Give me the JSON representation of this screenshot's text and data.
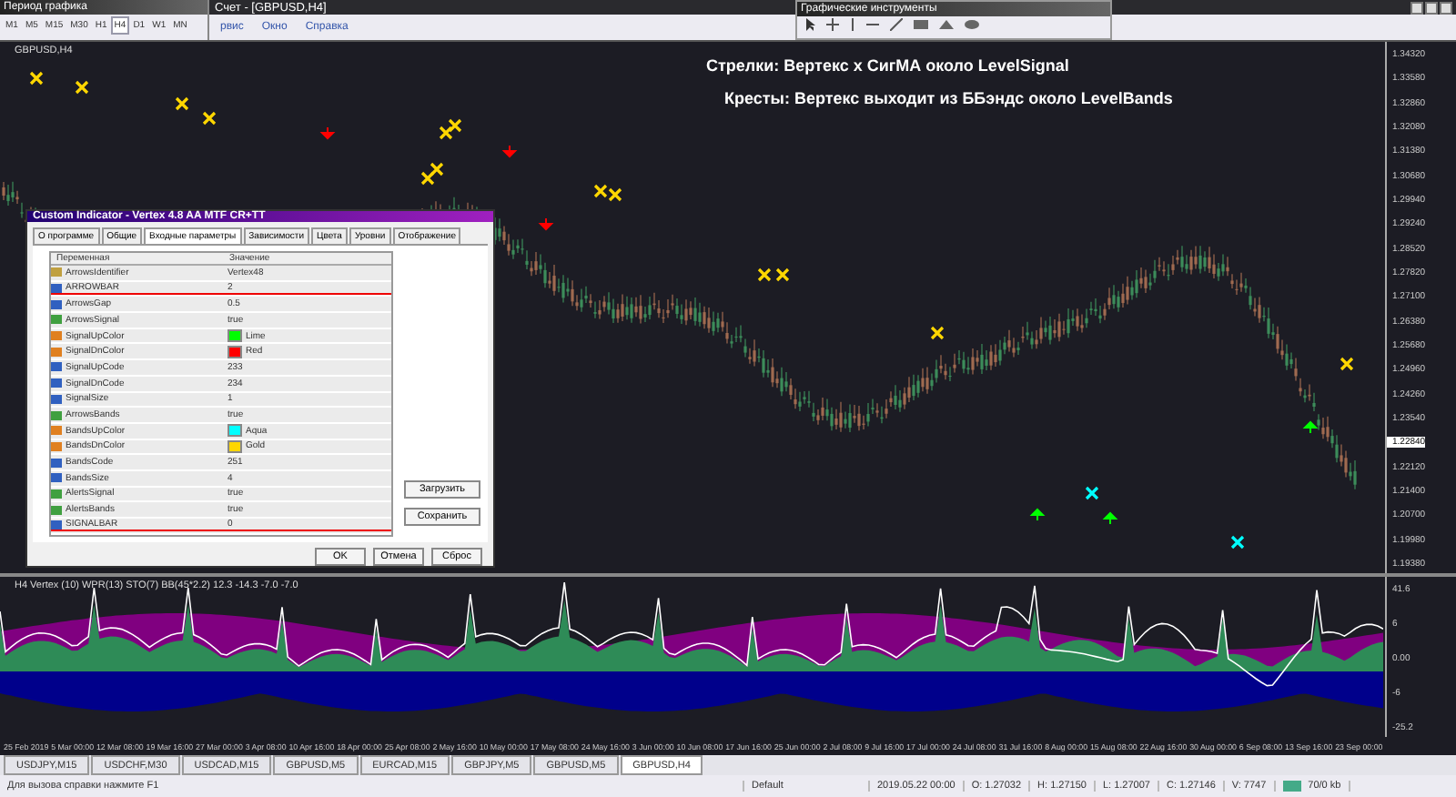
{
  "timeframe_toolbar": {
    "title": "Период графика",
    "buttons": [
      {
        "label": "M1",
        "selected": false
      },
      {
        "label": "M5",
        "selected": false
      },
      {
        "label": "M15",
        "selected": false
      },
      {
        "label": "M30",
        "selected": false
      },
      {
        "label": "H1",
        "selected": false
      },
      {
        "label": "H4",
        "selected": true
      },
      {
        "label": "D1",
        "selected": false
      },
      {
        "label": "W1",
        "selected": false
      },
      {
        "label": "MN",
        "selected": false
      }
    ]
  },
  "window": {
    "title": "Счет - [GBPUSD,H4]",
    "menu": [
      "рвис",
      "Окно",
      "Справка"
    ]
  },
  "drawing_toolbar": {
    "title": "Графические инструменты"
  },
  "chart": {
    "label": "GBPUSD,H4",
    "annotations": [
      "Стрелки: Вертекс х СигМА около LevelSignal",
      "Кресты: Вертекс выходит из ББэндс около LevelBands"
    ],
    "price_axis": [
      "1.34320",
      "1.33580",
      "1.32860",
      "1.32080",
      "1.31380",
      "1.30680",
      "1.29940",
      "1.29240",
      "1.28520",
      "1.27820",
      "1.27100",
      "1.26380",
      "1.25680",
      "1.24960",
      "1.24260",
      "1.23540",
      "1.22120",
      "1.21400",
      "1.20700",
      "1.19980",
      "1.19380"
    ],
    "current_price": "1.22840"
  },
  "dialog": {
    "title": "Custom Indicator - Vertex 4.8 AA MTF CR+TT",
    "tabs": [
      {
        "label": "О программе",
        "selected": false
      },
      {
        "label": "Общие",
        "selected": false
      },
      {
        "label": "Входные параметры",
        "selected": true
      },
      {
        "label": "Зависимости",
        "selected": false
      },
      {
        "label": "Цвета",
        "selected": false
      },
      {
        "label": "Уровни",
        "selected": false
      },
      {
        "label": "Отображение",
        "selected": false
      }
    ],
    "columns": [
      "Переменная",
      "Значение"
    ],
    "rows": [
      {
        "kind": "string",
        "name": "ArrowsIdentifier",
        "value": "Vertex48",
        "underlined": false
      },
      {
        "kind": "int",
        "name": "ARROWBAR",
        "value": "2",
        "underlined": true
      },
      {
        "kind": "double",
        "name": "ArrowsGap",
        "value": "0.5",
        "underlined": false
      },
      {
        "kind": "bool",
        "name": "ArrowsSignal",
        "value": "true",
        "underlined": false
      },
      {
        "kind": "color",
        "name": "SignalUpColor",
        "value": "Lime",
        "color": "#00ff00",
        "underlined": false
      },
      {
        "kind": "color",
        "name": "SignalDnColor",
        "value": "Red",
        "color": "#ff0000",
        "underlined": false
      },
      {
        "kind": "int",
        "name": "SignalUpCode",
        "value": "233",
        "underlined": false
      },
      {
        "kind": "int",
        "name": "SignalDnCode",
        "value": "234",
        "underlined": false
      },
      {
        "kind": "int",
        "name": "SignalSize",
        "value": "1",
        "underlined": false
      },
      {
        "kind": "bool",
        "name": "ArrowsBands",
        "value": "true",
        "underlined": false
      },
      {
        "kind": "color",
        "name": "BandsUpColor",
        "value": "Aqua",
        "color": "#00ffff",
        "underlined": false
      },
      {
        "kind": "color",
        "name": "BandsDnColor",
        "value": "Gold",
        "color": "#ffd700",
        "underlined": false
      },
      {
        "kind": "int",
        "name": "BandsCode",
        "value": "251",
        "underlined": false
      },
      {
        "kind": "int",
        "name": "BandsSize",
        "value": "4",
        "underlined": false
      },
      {
        "kind": "bool",
        "name": "AlertsSignal",
        "value": "true",
        "underlined": false
      },
      {
        "kind": "bool",
        "name": "AlertsBands",
        "value": "true",
        "underlined": false
      },
      {
        "kind": "int",
        "name": "SIGNALBAR",
        "value": "0",
        "underlined": true
      }
    ],
    "side_buttons": [
      "Загрузить",
      "Сохранить"
    ],
    "buttons": [
      "OK",
      "Отмена",
      "Сброс"
    ]
  },
  "indicator": {
    "label": "H4 Vertex (10) WPR(13) STO(7) BB(45*2.2) 12.3 -14.3 -7.0 -7.0",
    "axis": [
      "41.6",
      "6",
      "0.00",
      "-6",
      "-25.2"
    ]
  },
  "time_axis": [
    "25 Feb 2019",
    "5 Mar 00:00",
    "12 Mar 08:00",
    "19 Mar 16:00",
    "27 Mar 00:00",
    "3 Apr 08:00",
    "10 Apr 16:00",
    "18 Apr 00:00",
    "25 Apr 08:00",
    "2 May 16:00",
    "10 May 00:00",
    "17 May 08:00",
    "24 May 16:00",
    "3 Jun 00:00",
    "10 Jun 08:00",
    "17 Jun 16:00",
    "25 Jun 00:00",
    "2 Jul 08:00",
    "9 Jul 16:00",
    "17 Jul 00:00",
    "24 Jul 08:00",
    "31 Jul 16:00",
    "8 Aug 00:00",
    "15 Aug 08:00",
    "22 Aug 16:00",
    "30 Aug 00:00",
    "6 Sep 08:00",
    "13 Sep 16:00",
    "23 Sep 00:00"
  ],
  "chart_tabs": [
    {
      "label": "USDJPY,M15",
      "selected": false
    },
    {
      "label": "USDCHF,M30",
      "selected": false
    },
    {
      "label": "USDCAD,M15",
      "selected": false
    },
    {
      "label": "GBPUSD,M5",
      "selected": false
    },
    {
      "label": "EURCAD,M15",
      "selected": false
    },
    {
      "label": "GBPJPY,M5",
      "selected": false
    },
    {
      "label": "GBPUSD,M5",
      "selected": false
    },
    {
      "label": "GBPUSD,H4",
      "selected": true
    }
  ],
  "status_bar": {
    "hint": "Для вызова справки нажмите F1",
    "profile": "Default",
    "fields": [
      "2019.05.22 00:00",
      "O: 1.27032",
      "H: 1.27150",
      "L: 1.27007",
      "C: 1.27146",
      "V: 7747"
    ],
    "traffic": "70/0 kb"
  }
}
